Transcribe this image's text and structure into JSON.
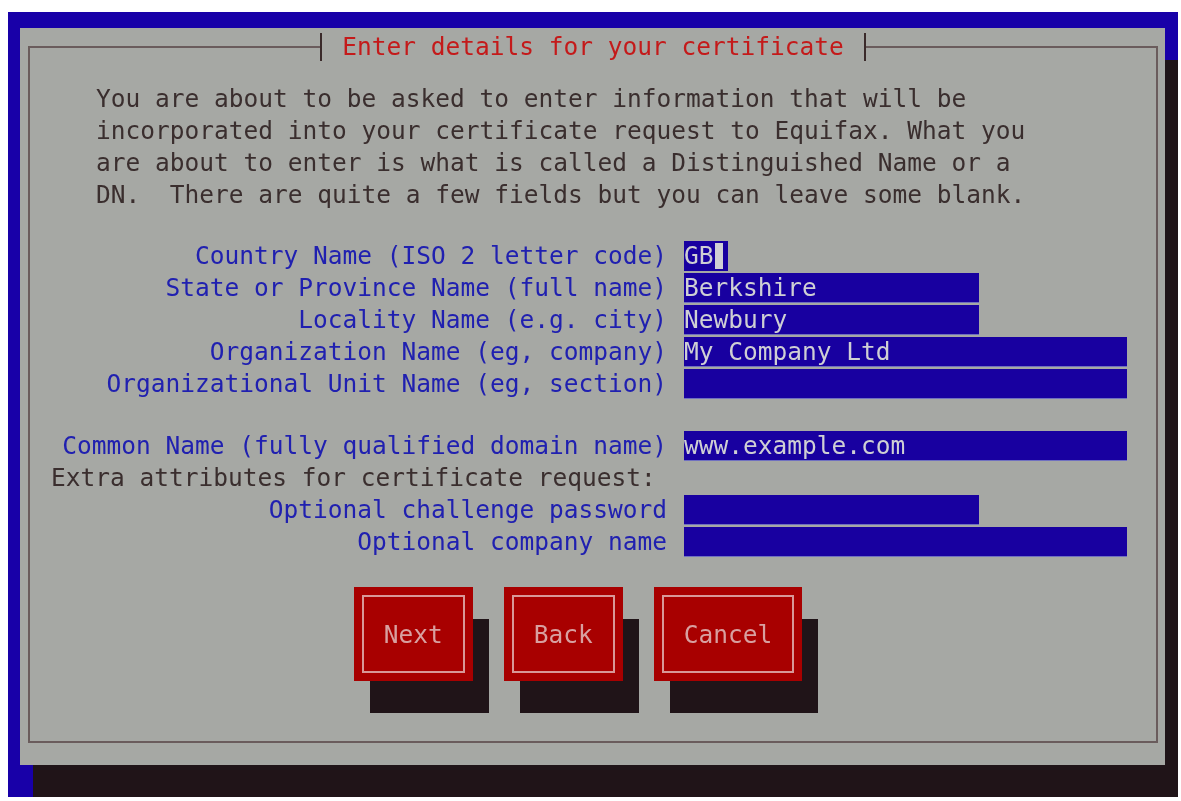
{
  "dialog": {
    "title": "Enter details for your certificate",
    "intro": "You are about to be asked to enter information that will be incorporated into your certificate request to Equifax. What you are about to enter is what is called a Distinguished Name or a DN.  There are quite a few fields but you can leave some blank.",
    "sections": [
      {
        "rows": [
          {
            "kind": "field",
            "label": "Country Name (ISO 2 letter code)",
            "value": "GB",
            "focused": true
          },
          {
            "kind": "field",
            "label": "State or Province Name (full name)",
            "value": "Berkshire",
            "focused": false
          },
          {
            "kind": "field",
            "label": "Locality Name (e.g. city)",
            "value": "Newbury",
            "focused": false
          },
          {
            "kind": "field",
            "label": "Organization Name (eg, company)",
            "value": "My Company Ltd",
            "focused": false
          },
          {
            "kind": "field",
            "label": "Organizational Unit Name (eg, section)",
            "value": "",
            "focused": false
          }
        ]
      },
      {
        "rows": [
          {
            "kind": "field",
            "label": "Common Name (fully qualified domain name)",
            "value": "www.example.com",
            "focused": false
          },
          {
            "kind": "heading",
            "label": "Extra attributes for certificate request:"
          },
          {
            "kind": "field",
            "label": "Optional challenge password",
            "value": "",
            "focused": false
          },
          {
            "kind": "field",
            "label": "Optional company name",
            "value": "",
            "focused": false
          }
        ]
      }
    ],
    "buttons": [
      "Next",
      "Back",
      "Cancel"
    ]
  }
}
